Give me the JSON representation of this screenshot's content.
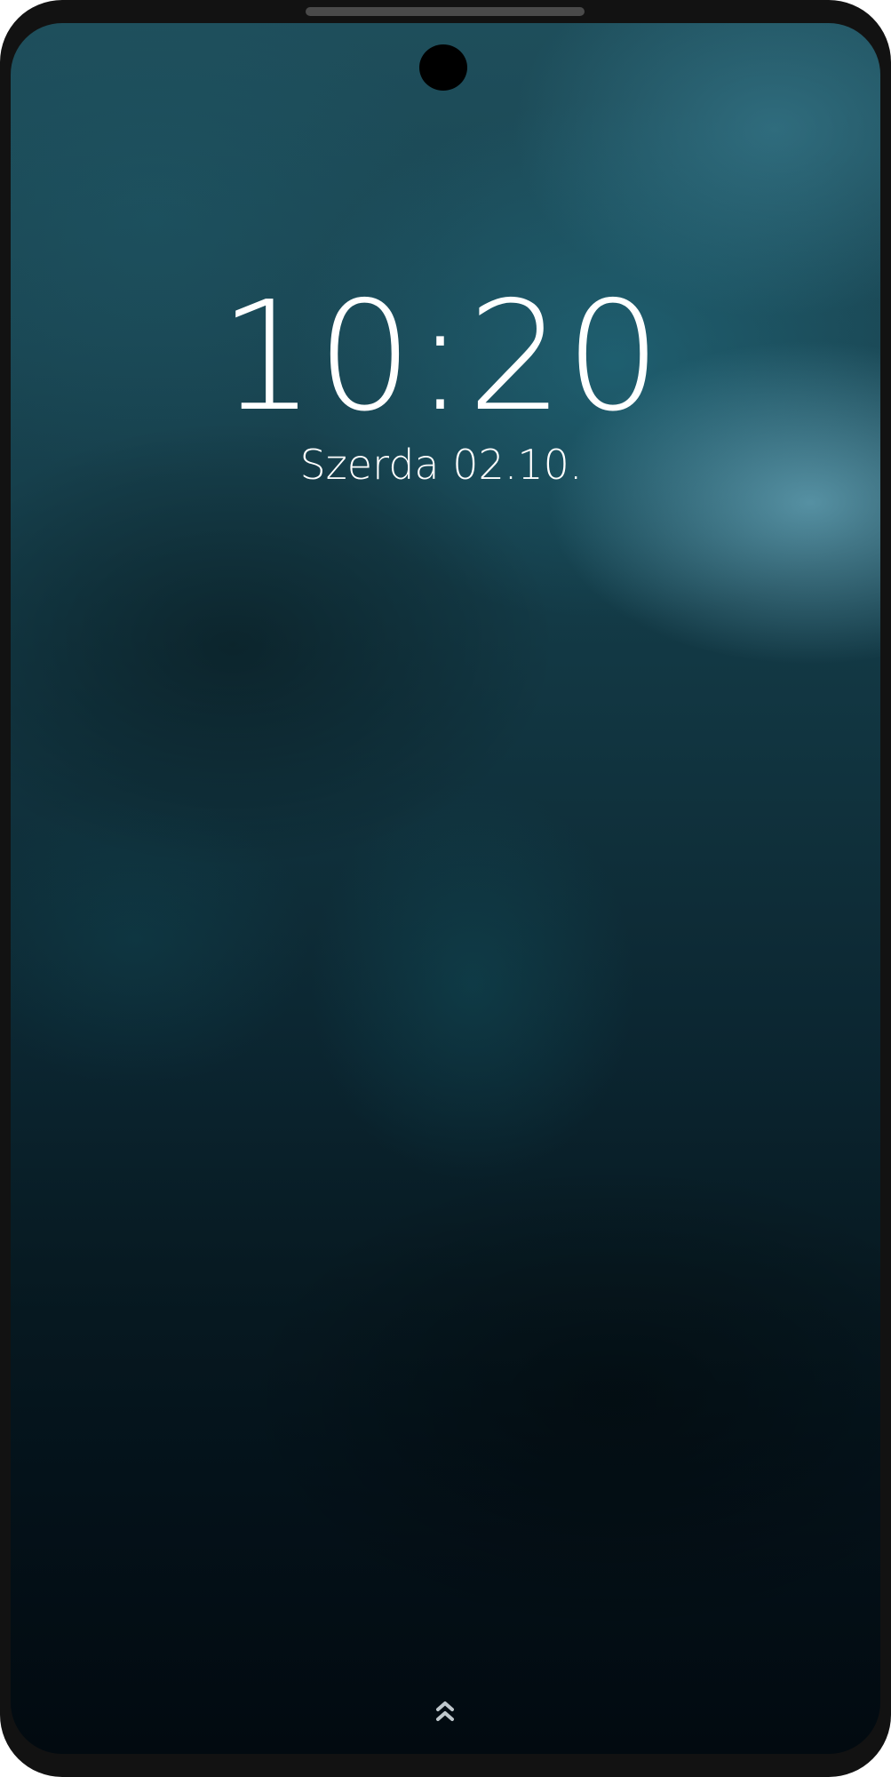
{
  "lockscreen": {
    "time": "10:20",
    "date": "Szerda 02.10.",
    "swipe_hint_icon": "chevron-double-up-icon"
  },
  "colors": {
    "frame": "#121212",
    "speaker": "#4a4a4a",
    "text": "#ffffff",
    "wallpaper_top": "#1e4e5b",
    "wallpaper_bottom": "#020a10"
  }
}
